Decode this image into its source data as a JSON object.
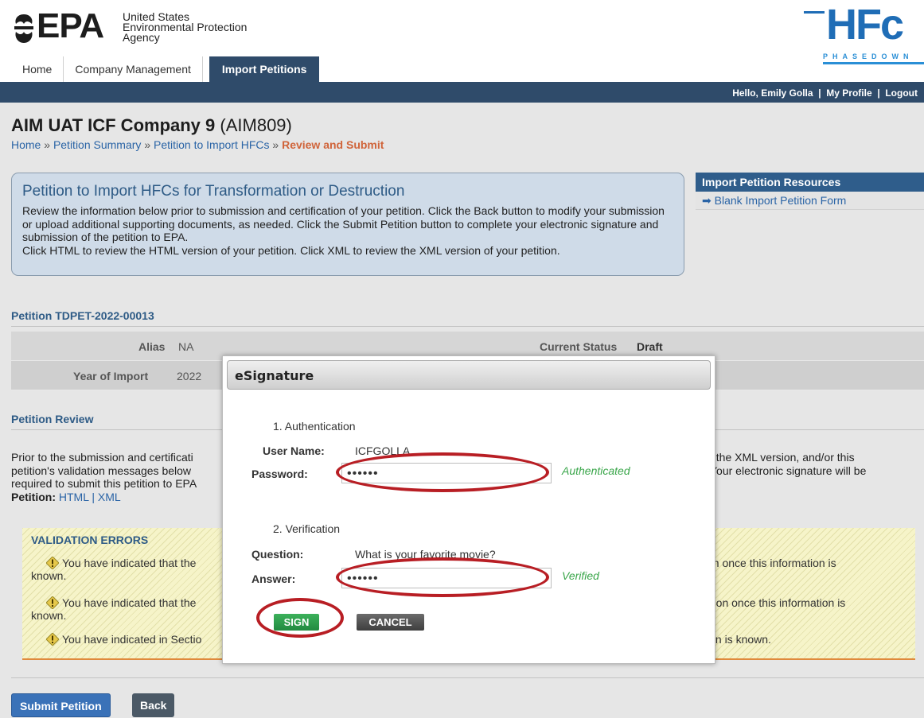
{
  "header": {
    "agency_short": "EPA",
    "agency_line1": "United States",
    "agency_line2": "Environmental Protection",
    "agency_line3": "Agency",
    "hfc_logo_text": "HFc",
    "hfc_logo_tagline": "PHASEDOWN",
    "tabs": [
      {
        "label": "Home"
      },
      {
        "label": "Company Management"
      },
      {
        "label": "Import Petitions",
        "active": true
      }
    ],
    "greeting": "Hello, Emily Golla",
    "my_profile": "My Profile",
    "logout": "Logout",
    "separator": "|"
  },
  "page": {
    "company_name": "AIM UAT ICF Company 9",
    "company_code": "(AIM809)",
    "breadcrumb": [
      {
        "label": "Home"
      },
      {
        "label": "Petition Summary"
      },
      {
        "label": "Petition to Import HFCs"
      },
      {
        "label": "Review and Submit",
        "current": true
      }
    ],
    "breadcrumb_sep": "»"
  },
  "infobox": {
    "title": "Petition to Import HFCs for Transformation or Destruction",
    "line1": "Review the information below prior to submission and certification of your petition. Click the Back button to modify your submission or upload additional supporting documents, as needed. Click the Submit Petition button to complete your electronic signature and submission of the petition to EPA.",
    "line2": "Click HTML to review the HTML version of your petition. Click XML to review the XML version of your petition."
  },
  "resources": {
    "title": "Import Petition Resources",
    "items": [
      {
        "label": "Blank Import Petition Form"
      }
    ]
  },
  "petition": {
    "title": "Petition TDPET-2022-00013",
    "alias_label": "Alias",
    "alias_value": "NA",
    "status_label": "Current Status",
    "status_value": "Draft",
    "year_label": "Year of Import",
    "year_value": "2022"
  },
  "review": {
    "title": "Petition Review",
    "text_left": "Prior to the submission and certificati",
    "text_left2": "petition's validation messages below",
    "text_left3": "required to submit this petition to EPA",
    "text_right": ", the XML version, and/or this",
    "text_right2": "Your electronic signature will be",
    "petition_label": "Petition:",
    "html_link": "HTML",
    "link_sep": "|",
    "xml_link": "XML"
  },
  "validation": {
    "title": "VALIDATION ERRORS",
    "items": [
      {
        "left": "You have indicated that the",
        "right": "nission once this information is",
        "wrap": "known."
      },
      {
        "left": "You have indicated that the",
        "right": "bmission once this information is",
        "wrap": "known."
      },
      {
        "left": "You have indicated in Sectio",
        "right": "rmation is known.",
        "wrap": ""
      }
    ]
  },
  "buttons": {
    "submit": "Submit Petition",
    "back": "Back"
  },
  "esignature": {
    "title": "eSignature",
    "section1": "1. Authentication",
    "username_label": "User Name:",
    "username_value": "ICFGOLLA",
    "password_label": "Password:",
    "password_value": "••••••",
    "auth_status": "Authenticated",
    "section2": "2. Verification",
    "question_label": "Question:",
    "question_value": "What is your favorite movie?",
    "answer_label": "Answer:",
    "answer_value": "••••••",
    "verify_status": "Verified",
    "sign": "SIGN",
    "cancel": "CANCEL"
  },
  "colors": {
    "nav_bar": "#2f4b6a",
    "breadcrumb_current": "#d0643a",
    "status_green": "#3aa64a",
    "annotation_red": "#b81e24",
    "validation_bg": "#f6f4c9"
  }
}
